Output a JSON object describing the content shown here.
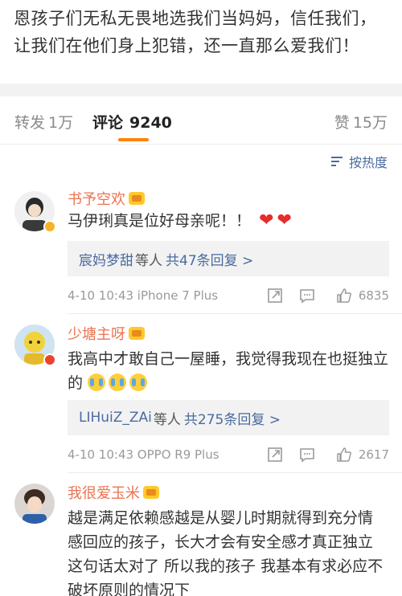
{
  "post": {
    "text": "恩孩子们无私无畏地选我们当妈妈，信任我们，让我们在他们身上犯错，还一直那么爱我们！"
  },
  "tabs": {
    "repost_label": "转发",
    "repost_count": "1万",
    "comment_label": "评论",
    "comment_count": "9240",
    "like_label": "赞",
    "like_count": "15万"
  },
  "sort": {
    "label": "按热度"
  },
  "comments": [
    {
      "name": "书予空欢",
      "text": "马伊琍真是位好母亲呢！！",
      "reply_user": "宸妈梦甜",
      "reply_mid": "等人",
      "reply_count": "共47条回复 >",
      "time": "4-10 10:43  iPhone 7 Plus",
      "likes": "6835"
    },
    {
      "name": "少塘主呀",
      "text": "我高中才敢自己一屋睡，我觉得我现在也挺独立的",
      "reply_user": "LIHuiZ_ZAi",
      "reply_mid": "等人",
      "reply_count": "共275条回复 >",
      "time": "4-10 10:43  OPPO R9 Plus",
      "likes": "2617"
    },
    {
      "name": "我很爱玉米",
      "text": "越是满足依赖感越是从婴儿时期就得到充分情感回应的孩子，长大才会有安全感才真正独立 这句话太对了 所以我的孩子 我基本有求必应不破坏原则的情况下"
    }
  ],
  "colors": {
    "accent": "#ff8200",
    "name": "#eb7350",
    "link": "#4a6b9f"
  }
}
